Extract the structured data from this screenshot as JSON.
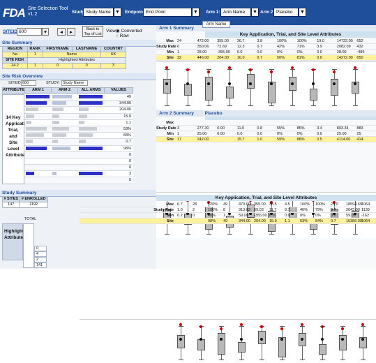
{
  "header": {
    "logo": "FDA",
    "app_title_line1": "Site Selection Tool",
    "app_title_line2": "v1.2",
    "study_label": "Study:",
    "study_value": "Study Name",
    "endpoint_label": "Endpoint:",
    "endpoint_value": "End Point",
    "arm1_label": "Arm 1:",
    "arm1_value": "Arm Name",
    "arm2_label": "Arm 2:",
    "arm2_value": "Placebo",
    "dropdown_arrow": "▼"
  },
  "site_controls": {
    "siteid_label": "SITEID:",
    "siteid_value": "600",
    "prev_btn": "◄",
    "next_btn": "►",
    "back_to_top": "Back to Top of List",
    "view_label": "View:",
    "view_opt1": "Converted",
    "view_opt2": "Raw"
  },
  "site_summary": {
    "title": "Site Summary",
    "headers": [
      "REGION",
      "RANK",
      "FIRSTNAME",
      "LASTNAME",
      "COUNTRY"
    ],
    "row1": [
      "Na",
      "1",
      "Name",
      "",
      "UK"
    ],
    "highlighted_label": "SITE RISK",
    "highlighted_text": "Highlighted Attributes",
    "row3": [
      "24.2",
      "1",
      "0",
      "0",
      "3"
    ]
  },
  "site_risk": {
    "title": "Site Risk Overview",
    "siteid_label": "SITEID:",
    "siteid_value": "600",
    "study_label": "STUDY:",
    "study_value": "Study Name",
    "headers": [
      "ATTRIBUTE",
      "ARM 1",
      "ARM 2",
      "ALL ARMS",
      "VALUES"
    ],
    "attr_label": "14 Key Application, Trial, and Site Level Attributes",
    "values": [
      "49",
      "344.00",
      "204.00",
      "15.9",
      "1.1",
      "53%",
      "84%",
      "0.7",
      "98%",
      "0",
      "0",
      "0",
      "3",
      "0"
    ]
  },
  "study_summary": {
    "title": "Study Summary",
    "headers": [
      "# SITES",
      "# ENROLLED"
    ],
    "values": [
      "147",
      "1192"
    ],
    "total_label": "TOTAL",
    "highlighted_label": "Highlighted Attributes",
    "counts": [
      "0",
      "4",
      "2",
      "141"
    ]
  },
  "arm1": {
    "title": "Arm 1 Summary",
    "tab": "Arm Name",
    "kal": "Key Application, Trial, and Site Level Attributes",
    "rows": [
      {
        "label": "Max",
        "vals": [
          "24",
          "472.00",
          "355.00",
          "36.7",
          "3.8",
          "100%",
          "100%",
          "19.0",
          "14722.00",
          "652"
        ]
      },
      {
        "label": "Study Rate",
        "vals": [
          "6",
          "350.06",
          "72.69",
          "12.3",
          "0.7",
          "42%",
          "71%",
          "3.9",
          "2082.09",
          "432"
        ]
      },
      {
        "label": "Min",
        "vals": [
          "1",
          "28.00",
          "-355.00",
          "0.0",
          "0.0",
          "0%",
          "0%",
          "0.0",
          "28.00",
          "-489"
        ]
      },
      {
        "label": "Site",
        "vals": [
          "32",
          "446.00",
          "204.00",
          "16.0",
          "0.7",
          "50%",
          "81%",
          "0.0",
          "14272.00",
          "650"
        ]
      }
    ]
  },
  "arm2": {
    "title": "Arm 2 Summary",
    "tab": "Placebo",
    "rows": [
      {
        "label": "Max",
        "vals": [
          "",
          "",
          "",
          "",
          "",
          "",
          "",
          "",
          "",
          ""
        ]
      },
      {
        "label": "Study Rate",
        "vals": [
          "3",
          "277.30",
          "0.00",
          "11.0",
          "0.8",
          "55%",
          "85%",
          "3.4",
          "803.34",
          "883"
        ]
      },
      {
        "label": "Min",
        "vals": [
          "1",
          "25.00",
          "0.00",
          "0.0",
          "0.0",
          "0%",
          "0%",
          "0.0",
          "25.00",
          "25"
        ]
      },
      {
        "label": "Site",
        "vals": [
          "17",
          "242.00",
          "",
          "15.7",
          "1.0",
          "59%",
          "88%",
          "0.5",
          "4114.00",
          "414"
        ]
      }
    ]
  },
  "all_arms": {
    "kal": "Key Application, Trial, and Site Level Attributes",
    "rows": [
      {
        "label": "Max",
        "vals": [
          "6.7",
          "28",
          "120%",
          "49",
          "470.00",
          "355.00",
          "36.5",
          "4.5",
          "100%",
          "100%",
          "23.0",
          "18594.69",
          "1064"
        ]
      },
      {
        "label": "Study Rate",
        "vals": [
          "1.0",
          "2",
          "100%",
          "8",
          "313.63",
          "69.03",
          "11.7",
          "0.7",
          "40%",
          "79%",
          "3.6",
          "2643.09",
          "1139"
        ]
      },
      {
        "label": "Min",
        "vals": [
          "0.2",
          "0",
          "40%",
          "1",
          "59.00",
          "-355.00",
          "0.0",
          "0.0",
          "0%",
          "0%",
          "0.0",
          "59.00",
          "-162"
        ]
      },
      {
        "label": "Site",
        "vals": [
          "",
          "",
          "98%",
          "49",
          "344.00",
          "204.00",
          "15.9",
          "1.1",
          "53%",
          "84%",
          "0.7",
          "16386.00",
          "1064"
        ]
      }
    ]
  },
  "colors": {
    "header": "#1f4e9b",
    "site_row": "#fff29a",
    "bar": "#2c2fc8",
    "site_marker": "#c00000"
  }
}
